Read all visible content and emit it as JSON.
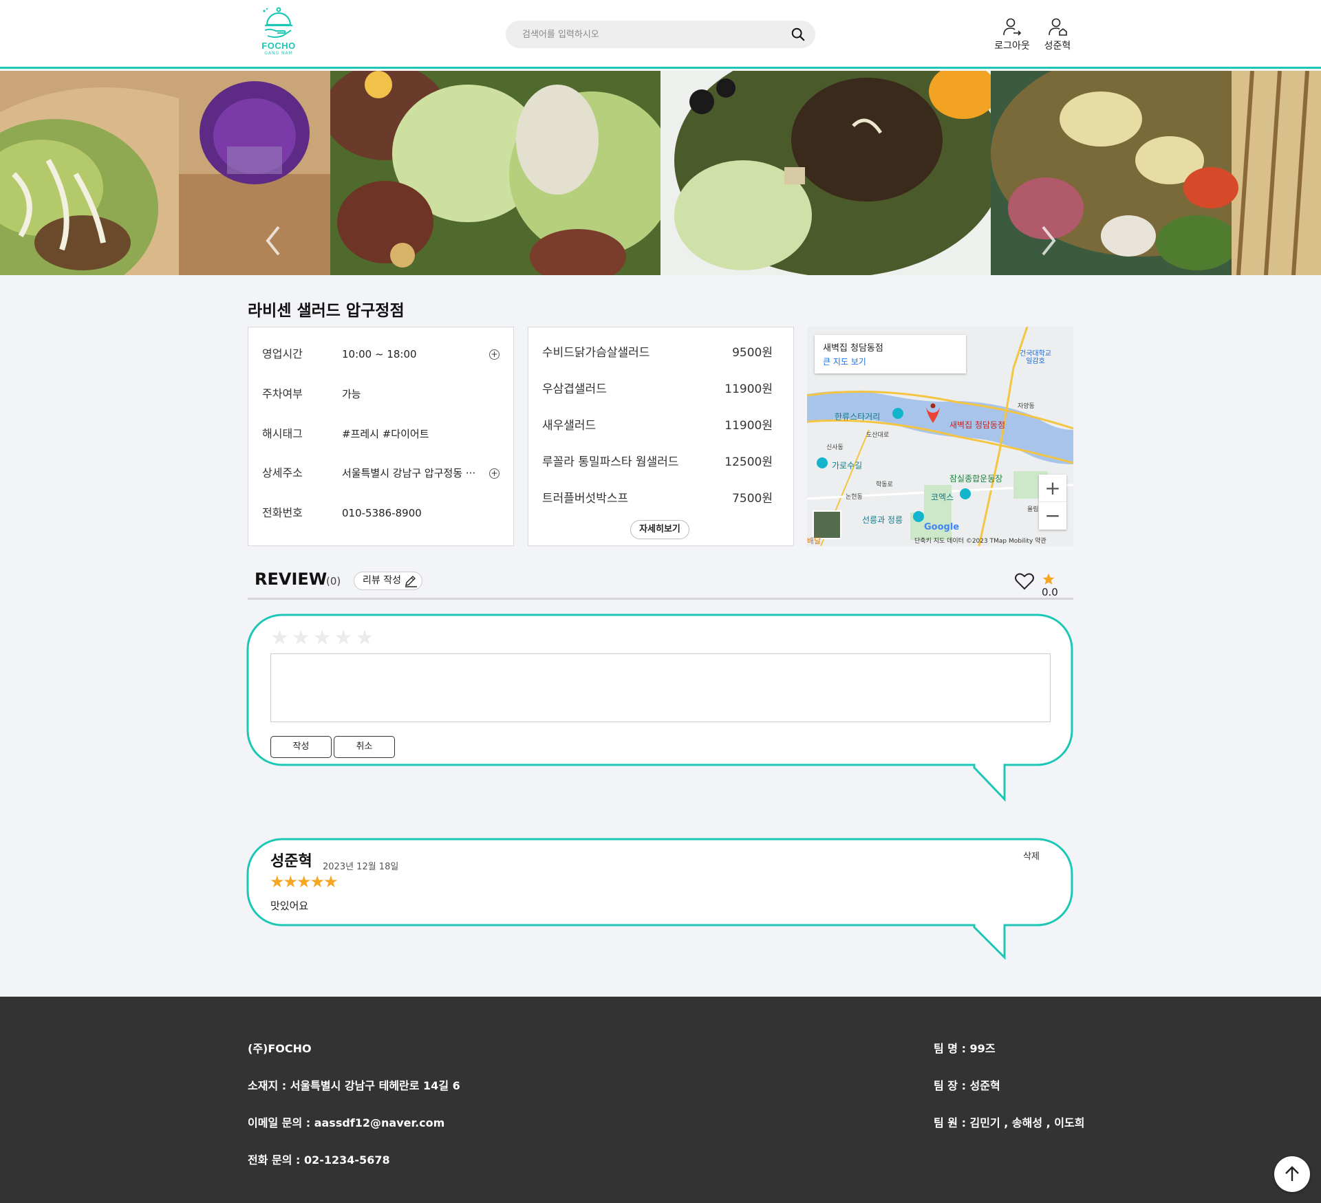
{
  "header": {
    "logo_text": "FOCHO",
    "logo_sub": "GANG NAM",
    "search_placeholder": "검색어를 입력하시오",
    "logout_label": "로그아웃",
    "user_label": "성준혁"
  },
  "store": {
    "name": "라비센 샐러드 압구정점",
    "info": [
      {
        "label": "영업시간",
        "value": "10:00 ~ 18:00"
      },
      {
        "label": "주차여부",
        "value": "가능"
      },
      {
        "label": "해시태그",
        "value": "#프레시 #다이어트"
      },
      {
        "label": "상세주소",
        "value": "서울특별시 강남구 압구정동 ···"
      },
      {
        "label": "전화번호",
        "value": "010-5386-8900"
      }
    ],
    "menu": [
      {
        "name": "수비드닭가슴살샐러드",
        "price": "9500원"
      },
      {
        "name": "우삼겹샐러드",
        "price": "11900원"
      },
      {
        "name": "새우샐러드",
        "price": "11900원"
      },
      {
        "name": "루꼴라 통밀파스타 웜샐러드",
        "price": "12500원"
      },
      {
        "name": "트러플버섯박스프",
        "price": "7500원"
      }
    ],
    "detail_button": "자세히보기"
  },
  "map": {
    "place_name": "새벽집 청담동점",
    "large_map_link": "큰 지도 보기",
    "pin_label": "새벽집 청담동점",
    "labels": {
      "hanryu": "한류스타거리",
      "garosu": "가로수길",
      "jamsil": "잠실종합운동장",
      "coex": "코엑스",
      "seolleung": "선릉과 정릉",
      "konkuk": "건국대학교 일감호",
      "jayang": "자양동",
      "sinsa": "신사동",
      "nonhyeon": "논현동",
      "hakdong": "학동로",
      "dosan": "도산대로",
      "olympic": "올림픽로",
      "google": "Google",
      "attribution": "단축키   지도 데이터 ©2023 TMap Mobility   약관",
      "baedal": "배달"
    },
    "zoom_in": "+",
    "zoom_out": "−"
  },
  "review": {
    "title": "REVIEW",
    "count": "(0)",
    "write_button": "리뷰 작성",
    "rating": "0.0",
    "form": {
      "submit": "작성",
      "cancel": "취소",
      "text_value": ""
    },
    "items": [
      {
        "author": "성준혁",
        "date": "2023년 12월 18일",
        "text": "맛있어요",
        "delete": "삭제",
        "stars": 5
      }
    ]
  },
  "footer": {
    "company": "(주)FOCHO",
    "address": "소재지 : 서울특별시 강남구 테헤란로 14길 6",
    "email": "이메일 문의 : aassdf12@naver.com",
    "phone": "전화 문의 : 02-1234-5678",
    "team_name": "팀 명 : 99즈",
    "team_leader": "팀 장 : 성준혁",
    "team_members": "팀 원 : 김민기 , 송해성 , 이도희"
  },
  "colors": {
    "accent": "#1cc7b6",
    "star": "#f5a623",
    "footer_bg": "#333333",
    "page_bg": "#f2f4f8"
  }
}
